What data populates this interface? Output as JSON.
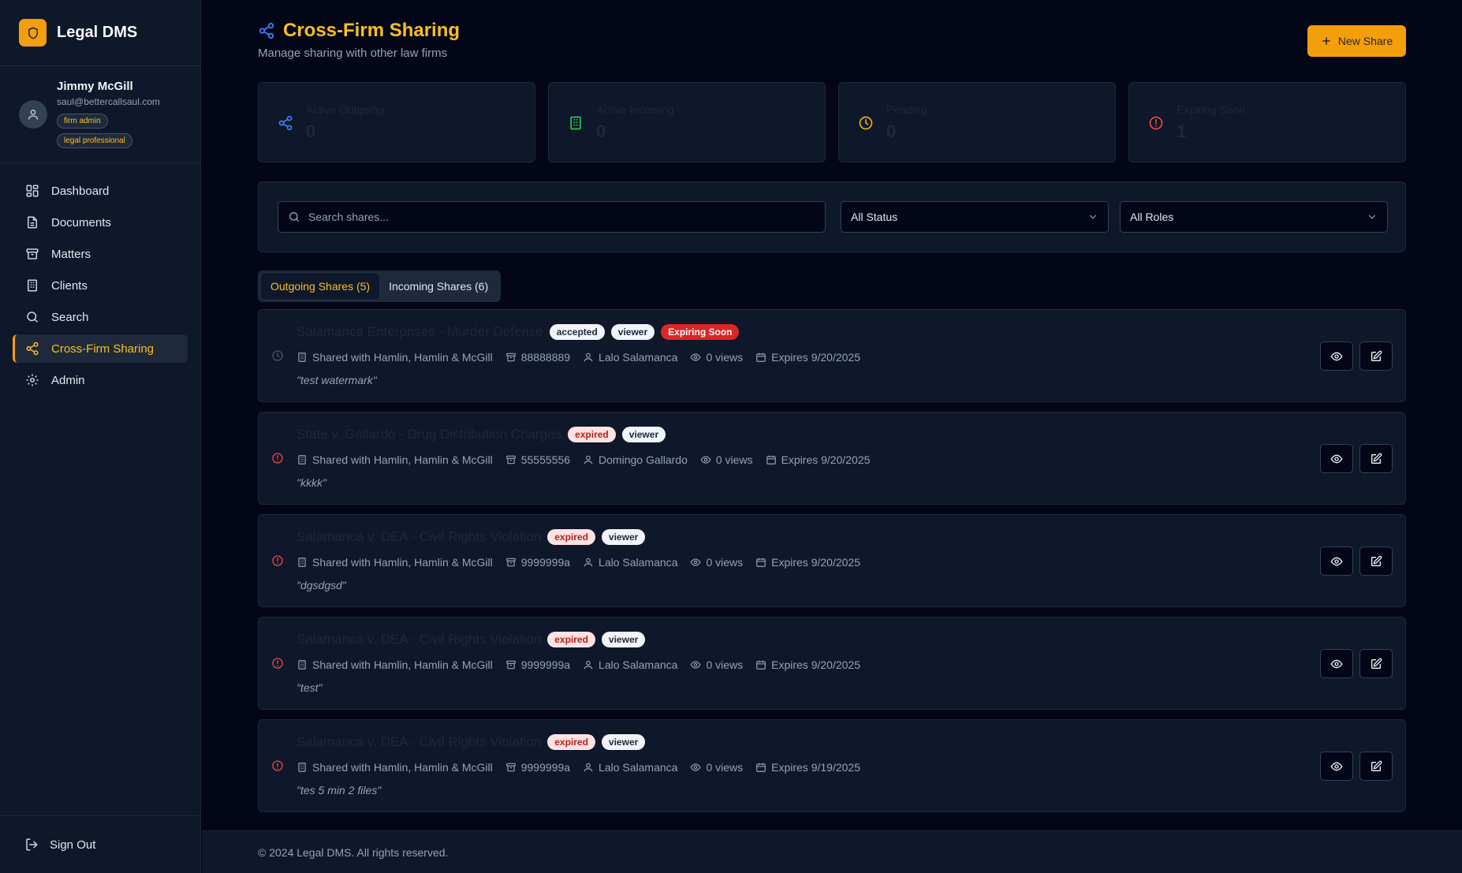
{
  "app": {
    "name": "Legal DMS"
  },
  "user": {
    "name": "Jimmy McGill",
    "email": "saul@bettercallsaul.com",
    "roles": [
      "firm admin",
      "legal professional"
    ]
  },
  "nav": [
    {
      "label": "Dashboard",
      "icon": "dashboard-icon"
    },
    {
      "label": "Documents",
      "icon": "document-icon"
    },
    {
      "label": "Matters",
      "icon": "archive-icon"
    },
    {
      "label": "Clients",
      "icon": "building-icon"
    },
    {
      "label": "Search",
      "icon": "search-icon"
    },
    {
      "label": "Cross-Firm Sharing",
      "icon": "share-icon",
      "active": true
    },
    {
      "label": "Admin",
      "icon": "gear-icon"
    }
  ],
  "signout": {
    "label": "Sign Out"
  },
  "page": {
    "title": "Cross-Firm Sharing",
    "subtitle": "Manage sharing with other law firms",
    "new_share_label": "New Share"
  },
  "stats": [
    {
      "label": "Active Outgoing",
      "value": "0",
      "icon": "share-icon",
      "color": "#3b82f6"
    },
    {
      "label": "Active Incoming",
      "value": "0",
      "icon": "building-icon",
      "color": "#22c55e"
    },
    {
      "label": "Pending",
      "value": "0",
      "icon": "clock-icon",
      "color": "#eab308"
    },
    {
      "label": "Expiring Soon",
      "value": "1",
      "icon": "alert-circle-icon",
      "color": "#ef4444"
    }
  ],
  "filters": {
    "search_placeholder": "Search shares...",
    "status_value": "All Status",
    "roles_value": "All Roles"
  },
  "tabs": [
    {
      "label": "Outgoing Shares (5)",
      "active": true
    },
    {
      "label": "Incoming Shares (6)"
    }
  ],
  "shares": [
    {
      "title": "Salamanca Enterprises - Murder Defense",
      "status_icon": "clock-icon",
      "badges": [
        {
          "text": "accepted",
          "kind": "accepted"
        },
        {
          "text": "viewer",
          "kind": "viewer"
        },
        {
          "text": "Expiring Soon",
          "kind": "expiring"
        }
      ],
      "shared_with": "Shared with Hamlin, Hamlin & McGill",
      "matter": "88888889",
      "client": "Lalo Salamanca",
      "views": "0 views",
      "expires": "Expires 9/20/2025",
      "note": "\"test watermark\""
    },
    {
      "title": "State v. Gallardo - Drug Distribution Charges",
      "status_icon": "alert-circle-icon",
      "badges": [
        {
          "text": "expired",
          "kind": "expired"
        },
        {
          "text": "viewer",
          "kind": "viewer"
        }
      ],
      "shared_with": "Shared with Hamlin, Hamlin & McGill",
      "matter": "55555556",
      "client": "Domingo Gallardo",
      "views": "0 views",
      "expires": "Expires 9/20/2025",
      "note": "\"kkkk\""
    },
    {
      "title": "Salamanca v. DEA - Civil Rights Violation",
      "status_icon": "alert-circle-icon",
      "badges": [
        {
          "text": "expired",
          "kind": "expired"
        },
        {
          "text": "viewer",
          "kind": "viewer"
        }
      ],
      "shared_with": "Shared with Hamlin, Hamlin & McGill",
      "matter": "9999999a",
      "client": "Lalo Salamanca",
      "views": "0 views",
      "expires": "Expires 9/20/2025",
      "note": "\"dgsdgsd\""
    },
    {
      "title": "Salamanca v. DEA - Civil Rights Violation",
      "status_icon": "alert-circle-icon",
      "badges": [
        {
          "text": "expired",
          "kind": "expired"
        },
        {
          "text": "viewer",
          "kind": "viewer"
        }
      ],
      "shared_with": "Shared with Hamlin, Hamlin & McGill",
      "matter": "9999999a",
      "client": "Lalo Salamanca",
      "views": "0 views",
      "expires": "Expires 9/20/2025",
      "note": "\"test\""
    },
    {
      "title": "Salamanca v. DEA - Civil Rights Violation",
      "status_icon": "alert-circle-icon",
      "badges": [
        {
          "text": "expired",
          "kind": "expired"
        },
        {
          "text": "viewer",
          "kind": "viewer"
        }
      ],
      "shared_with": "Shared with Hamlin, Hamlin & McGill",
      "matter": "9999999a",
      "client": "Lalo Salamanca",
      "views": "0 views",
      "expires": "Expires 9/19/2025",
      "note": "\"tes 5 min 2 files\""
    }
  ],
  "footer": {
    "text": "© 2024 Legal DMS. All rights reserved."
  },
  "colors": {
    "accent": "#f59e0b",
    "accent_text": "#fbbf24",
    "danger": "#ef4444"
  }
}
